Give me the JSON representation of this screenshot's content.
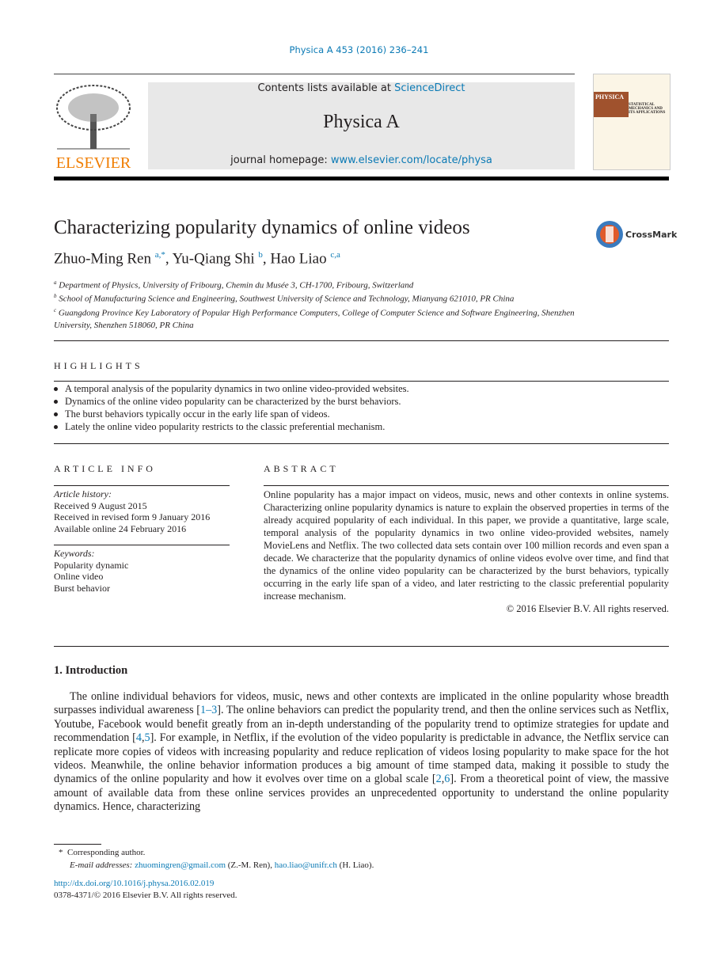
{
  "header": {
    "citation": "Physica A 453 (2016) 236–241",
    "contents_prefix": "Contents lists available at ",
    "contents_link": "ScienceDirect",
    "journal": "Physica A",
    "homepage_prefix": "journal homepage: ",
    "homepage_link": "www.elsevier.com/locate/physa",
    "publisher": "ELSEVIER",
    "cover_title": "PHYSICA",
    "cover_subtitle": "STATISTICAL MECHANICS AND ITS APPLICATIONS"
  },
  "article": {
    "title": "Characterizing popularity dynamics of online videos",
    "crossmark": "CrossMark",
    "authors": [
      {
        "name": "Zhuo-Ming Ren",
        "sup": "a,*"
      },
      {
        "name": "Yu-Qiang Shi",
        "sup": "b"
      },
      {
        "name": "Hao Liao",
        "sup": "c,a"
      }
    ],
    "affiliations": [
      {
        "sup": "a",
        "text": "Department of Physics, University of Fribourg, Chemin du Musée 3, CH-1700, Fribourg, Switzerland"
      },
      {
        "sup": "b",
        "text": "School of Manufacturing Science and Engineering, Southwest University of Science and Technology, Mianyang 621010, PR China"
      },
      {
        "sup": "c",
        "text": "Guangdong Province Key Laboratory of Popular High Performance Computers, College of Computer Science and Software Engineering, Shenzhen University, Shenzhen 518060, PR China"
      }
    ]
  },
  "highlights": {
    "heading": "HIGHLIGHTS",
    "items": [
      "A temporal analysis of the popularity dynamics in two online video-provided websites.",
      "Dynamics of the online video popularity can be characterized by the burst behaviors.",
      "The burst behaviors typically occur in the early life span of videos.",
      "Lately the online video popularity restricts to the classic preferential mechanism."
    ]
  },
  "article_info": {
    "heading": "ARTICLE INFO",
    "history_label": "Article history:",
    "history": [
      "Received 9 August 2015",
      "Received in revised form 9 January 2016",
      "Available online 24 February 2016"
    ],
    "keywords_label": "Keywords:",
    "keywords": [
      "Popularity dynamic",
      "Online video",
      "Burst behavior"
    ]
  },
  "abstract": {
    "heading": "ABSTRACT",
    "text": "Online popularity has a major impact on videos, music, news and other contexts in online systems. Characterizing online popularity dynamics is nature to explain the observed properties in terms of the already acquired popularity of each individual. In this paper, we provide a quantitative, large scale, temporal analysis of the popularity dynamics in two online video-provided websites, namely MovieLens and Netflix. The two collected data sets contain over 100 million records and even span a decade. We characterize that the popularity dynamics of online videos evolve over time, and find that the dynamics of the online video popularity can be characterized by the burst behaviors, typically occurring in the early life span of a video, and later restricting to the classic preferential popularity increase mechanism.",
    "copyright": "© 2016 Elsevier B.V. All rights reserved."
  },
  "intro": {
    "heading": "1.  Introduction",
    "segments": [
      {
        "t": "The online individual behaviors for videos, music, news and other contexts are implicated in the online popularity whose breadth surpasses individual awareness ["
      },
      {
        "t": "1–3",
        "link": true
      },
      {
        "t": "]. The online behaviors can predict the popularity trend, and then the online services such as Netflix, Youtube, Facebook would benefit greatly from an in-depth understanding of the popularity trend to optimize strategies for update and recommendation ["
      },
      {
        "t": "4",
        "link": true
      },
      {
        "t": ","
      },
      {
        "t": "5",
        "link": true
      },
      {
        "t": "]. For example, in Netflix, if the evolution of the video popularity is predictable in advance, the Netflix service can replicate more copies of videos with increasing popularity and reduce replication of videos losing popularity to make space for the hot videos. Meanwhile, the online behavior information produces a big amount of time stamped data, making it possible to study the dynamics of the online popularity and how it evolves over time on a global scale ["
      },
      {
        "t": "2",
        "link": true
      },
      {
        "t": ","
      },
      {
        "t": "6",
        "link": true
      },
      {
        "t": "]. From a theoretical point of view, the massive amount of available data from these online services provides an unprecedented opportunity to understand the online popularity dynamics. Hence, characterizing"
      }
    ]
  },
  "footnotes": {
    "star": "*",
    "corresponding": "Corresponding author.",
    "email_label": "E-mail addresses:",
    "email1": "zhuomingren@gmail.com",
    "email1_who": " (Z.-M. Ren), ",
    "email2": "hao.liao@unifr.ch",
    "email2_who": " (H. Liao).",
    "doi": "http://dx.doi.org/10.1016/j.physa.2016.02.019",
    "issn": "0378-4371/© 2016 Elsevier B.V. All rights reserved."
  },
  "colors": {
    "link": "#0b7ab5",
    "banner": "#e8e8e8",
    "elsevier_orange": "#f07d00"
  }
}
